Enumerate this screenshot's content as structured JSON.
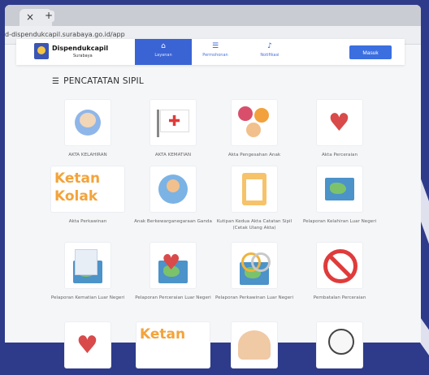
{
  "browser": {
    "tab_close": "×",
    "new_tab": "+",
    "url": "d-dispendukcapil.surabaya.go.id/app"
  },
  "nav": {
    "brand_name": "Dispendukcapil",
    "brand_sub": "Surabaya",
    "items": [
      {
        "label": "Layanan",
        "icon": "home-icon"
      },
      {
        "label": "Permohonan",
        "icon": "list-icon"
      },
      {
        "label": "Notifikasi",
        "icon": "bell-icon"
      }
    ],
    "login_label": "Masuk"
  },
  "section": {
    "title": "PENCATATAN SIPIL"
  },
  "services": [
    "AKTA KELAHIRAN",
    "AKTA KEMATIAN",
    "Akta Pengesahan Anak",
    "Akta Perceraian",
    "Akta Perkawinan",
    "Anak Berkewarganegaraan Ganda",
    "Kutipan Kedua Akta Catatan Sipil (Cetak Ulang Akta)",
    "Pelaporan Kelahiran Luar Negeri",
    "Pelaporan Kematian Luar Negeri",
    "Pelaporan Perceraian Luar Negeri",
    "Pelaporan Perkawinan Luar Negeri",
    "Pembatalan Perceraian"
  ],
  "logo_text": {
    "line1": "Ketan",
    "line2": "Kolak"
  },
  "colors": {
    "accent": "#3a63d4",
    "login_button": "#3b6fe0",
    "background": "#2e3b8a"
  }
}
